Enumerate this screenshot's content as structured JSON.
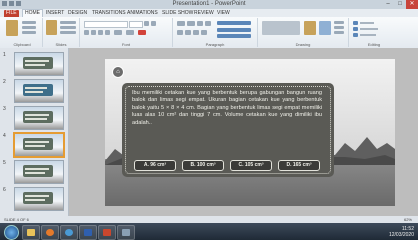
{
  "window": {
    "title": "Presentation1 - PowerPoint",
    "minimize": "–",
    "maximize": "□",
    "close": "✕"
  },
  "ribbon": {
    "file_tab": "FILE",
    "tabs": [
      "HOME",
      "INSERT",
      "DESIGN",
      "TRANSITIONS",
      "ANIMATIONS",
      "SLIDE SHOW",
      "REVIEW",
      "VIEW"
    ],
    "active_tab": "HOME",
    "groups": [
      "Clipboard",
      "Slides",
      "Font",
      "Paragraph",
      "Drawing",
      "Editing"
    ]
  },
  "slide": {
    "question": "Ibu memiliki cetakan kue yang berbentuk berupa gabungan bangun ruang balok dan limas segi empat. Ukuran bagian cetakan kue yang berbentuk balok yaitu 5 × 8 × 4 cm. Bagian yang berbentuk limas segi empat memiliki luas alas 10 cm² dan tinggi 7 cm. Volume cetakan kue yang dimiliki ibu adalah..",
    "options": [
      {
        "label": "A. 96 cm³"
      },
      {
        "label": "B. 100 cm³"
      },
      {
        "label": "C. 105 cm³"
      },
      {
        "label": "D. 165 cm³"
      }
    ]
  },
  "thumbnails": [
    "1",
    "2",
    "3",
    "4",
    "5",
    "6"
  ],
  "colors": {
    "accent": "#e59c33",
    "board": "#5a5a55",
    "file_tab": "#c0402f"
  },
  "status_bar": {
    "slide_info": "SLIDE 4 OF 6",
    "zoom": "62%"
  },
  "taskbar": {
    "time": "11:52",
    "date": "12/03/2020"
  }
}
